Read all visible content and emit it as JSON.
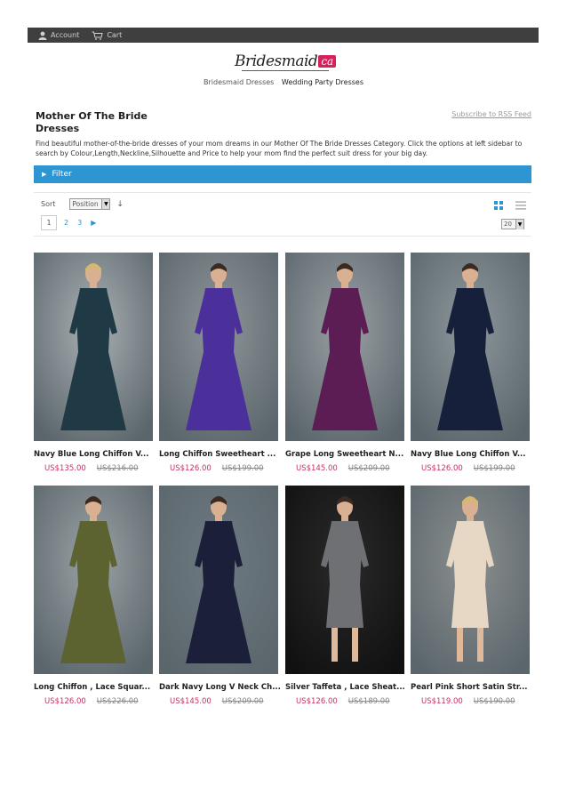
{
  "topbar": {
    "account": "Account",
    "cart": "Cart"
  },
  "logo": {
    "text": "Bridesmaid",
    "badge": "ca"
  },
  "nav": {
    "items": [
      "Bridesmaid Dresses",
      "Wedding Party Dresses"
    ]
  },
  "page": {
    "title": "Mother Of The Bride Dresses",
    "rss": "Subscribe to RSS Feed",
    "description": "Find beautiful mother-of-the-bride dresses of your mom dreams in our Mother Of The Bride Dresses Category. Click the options at left sidebar to search by Colour,Length,Neckline,Silhouette and Price to help your mom find the perfect suit dress for your big day."
  },
  "filter": {
    "label": "Filter"
  },
  "toolbar": {
    "sort_label": "Sort",
    "sort_value": "Position",
    "pages": [
      "1",
      "2",
      "3"
    ],
    "current_page": "1",
    "limit": "20"
  },
  "colors": {
    "accent": "#2e95d3",
    "price": "#c8306a",
    "topbar": "#3f3f3f",
    "brand": "#d2235a"
  },
  "products": [
    {
      "name": "Navy Blue Long Chiffon V...",
      "price": "US$135.00",
      "old_price": "US$216.00",
      "dress_color": "#1f3a44",
      "bg": "#a9b0b3"
    },
    {
      "name": "Long Chiffon Sweetheart ...",
      "price": "US$126.00",
      "old_price": "US$199.00",
      "dress_color": "#4b2f9b",
      "bg": "#8e9599"
    },
    {
      "name": "Grape Long Sweetheart N...",
      "price": "US$145.00",
      "old_price": "US$209.00",
      "dress_color": "#5c1d55",
      "bg": "#9aa0a4"
    },
    {
      "name": "Navy Blue Long Chiffon V...",
      "price": "US$126.00",
      "old_price": "US$199.00",
      "dress_color": "#16203a",
      "bg": "#8d979c"
    },
    {
      "name": "Long Chiffon , Lace Squar...",
      "price": "US$126.00",
      "old_price": "US$226.00",
      "dress_color": "#5c6330",
      "bg": "#9aa2a4"
    },
    {
      "name": "Dark Navy Long V Neck Ch...",
      "price": "US$145.00",
      "old_price": "US$209.00",
      "dress_color": "#1c1f3a",
      "bg": "#6e7a82"
    },
    {
      "name": "Silver Taffeta , Lace Sheat...",
      "price": "US$126.00",
      "old_price": "US$189.00",
      "dress_color": "#6e7074",
      "bg": "#2a2a2a"
    },
    {
      "name": "Pearl Pink Short Satin Str...",
      "price": "US$119.00",
      "old_price": "US$190.00",
      "dress_color": "#e7d8c6",
      "bg": "#8c9090"
    }
  ]
}
